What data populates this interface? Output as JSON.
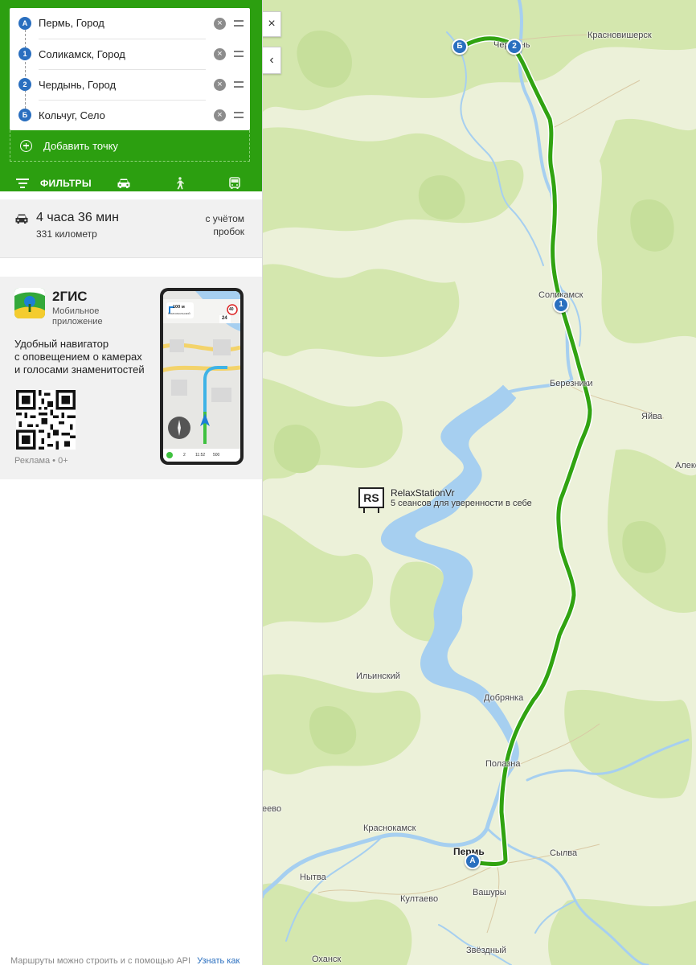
{
  "route": {
    "stops": [
      {
        "marker": "А",
        "name": "Пермь, Город"
      },
      {
        "marker": "1",
        "name": "Соликамск, Город"
      },
      {
        "marker": "2",
        "name": "Чердынь, Город"
      },
      {
        "marker": "Б",
        "name": "Кольчуг, Село"
      }
    ],
    "add_point_label": "Добавить точку"
  },
  "modebar": {
    "filters_label": "ФИЛЬТРЫ",
    "modes": [
      "car",
      "pedestrian",
      "public-transport"
    ],
    "active_mode": "car"
  },
  "summary": {
    "time": "4 часа 36 мин",
    "distance": "331 километр",
    "traffic_line1": "с учётом",
    "traffic_line2": "пробок"
  },
  "ad": {
    "brand": "2ГИС",
    "brand_sub_line1": "Мобильное",
    "brand_sub_line2": "приложение",
    "desc_line1": "Удобный навигатор",
    "desc_line2": "с оповещением о камерах",
    "desc_line3": "и голосами знаменитостей",
    "footer": "Реклама • 0+",
    "phone_distance": "100 м",
    "phone_street": "Комсомольский",
    "phone_speed_limit": "40",
    "phone_speed": "24",
    "phone_eta": "11:52",
    "phone_minutes": "2",
    "phone_meters": "500"
  },
  "map": {
    "labels": {
      "krasnovishersk": "Красновишерск",
      "cherdyn": "Чердынь",
      "solikamsk": "Соликамск",
      "berezniki": "Березники",
      "yayva": "Яйва",
      "aleks": "Алекс",
      "ilinsky": "Ильинский",
      "dobryanka": "Добрянка",
      "polazna": "Полазна",
      "krasnokamsk": "Краснокамск",
      "perm": "Пермь",
      "sylva": "Сылва",
      "nytva": "Нытва",
      "kultaevo": "Култаево",
      "vashury": "Вашуры",
      "zvezdny": "Звёздный",
      "okhansk": "Оханск",
      "eevo": "еево"
    },
    "ad_marker": {
      "logo": "RS",
      "title": "RelaxStationVr",
      "subtitle": "5 сеансов для уверенности в себе"
    },
    "pins": {
      "a": "А",
      "one": "1",
      "two": "2",
      "b": "Б"
    },
    "close_icon": "×",
    "collapse_icon": "‹"
  },
  "footer": {
    "note": "Маршруты можно строить и с помощью API",
    "link": "Узнать как"
  },
  "colors": {
    "panel_green": "#2c9f10",
    "route_green": "#31a311",
    "pin_blue": "#2a6fbf",
    "water": "#a6cff0",
    "forest": "#cfe4a6"
  }
}
